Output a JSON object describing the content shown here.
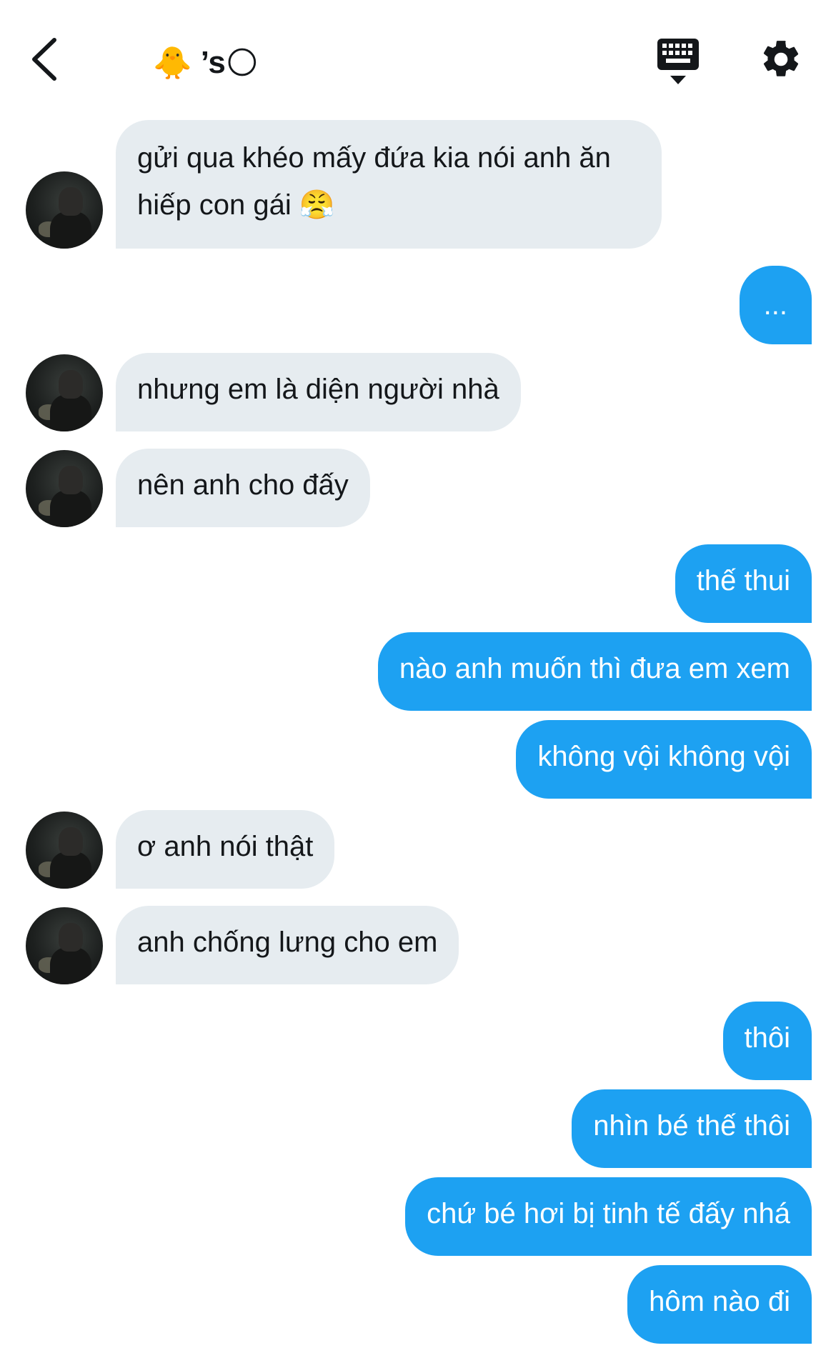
{
  "header": {
    "title_prefix_emoji": "🐥",
    "title_text": "’s",
    "title_suffix_emoji": "🌕",
    "icons": [
      "back-arrow-icon",
      "keyboard-icon",
      "gear-icon"
    ]
  },
  "messages": [
    {
      "side": "in",
      "text": "gửi qua khéo mấy đứa kia nói anh ăn hiếp con gái 😤"
    },
    {
      "side": "out",
      "text": "..."
    },
    {
      "side": "in",
      "text": "nhưng em là diện người nhà"
    },
    {
      "side": "in",
      "text": "nên anh cho đấy"
    },
    {
      "side": "out",
      "text": "thế thui"
    },
    {
      "side": "out",
      "text": "nào anh muốn thì đưa em xem"
    },
    {
      "side": "out",
      "text": "không vội không vội"
    },
    {
      "side": "in",
      "text": "ơ anh nói thật"
    },
    {
      "side": "in",
      "text": "anh chống lưng cho em"
    },
    {
      "side": "out",
      "text": "thôi"
    },
    {
      "side": "out",
      "text": "nhìn bé thế thôi"
    },
    {
      "side": "out",
      "text": "chứ bé hơi bị tinh tế đấy nhá"
    },
    {
      "side": "out",
      "text": "hôm nào đi"
    }
  ],
  "colors": {
    "outgoing_bubble": "#1da1f2",
    "incoming_bubble": "#e6ecf0",
    "text_dark": "#14171a"
  }
}
